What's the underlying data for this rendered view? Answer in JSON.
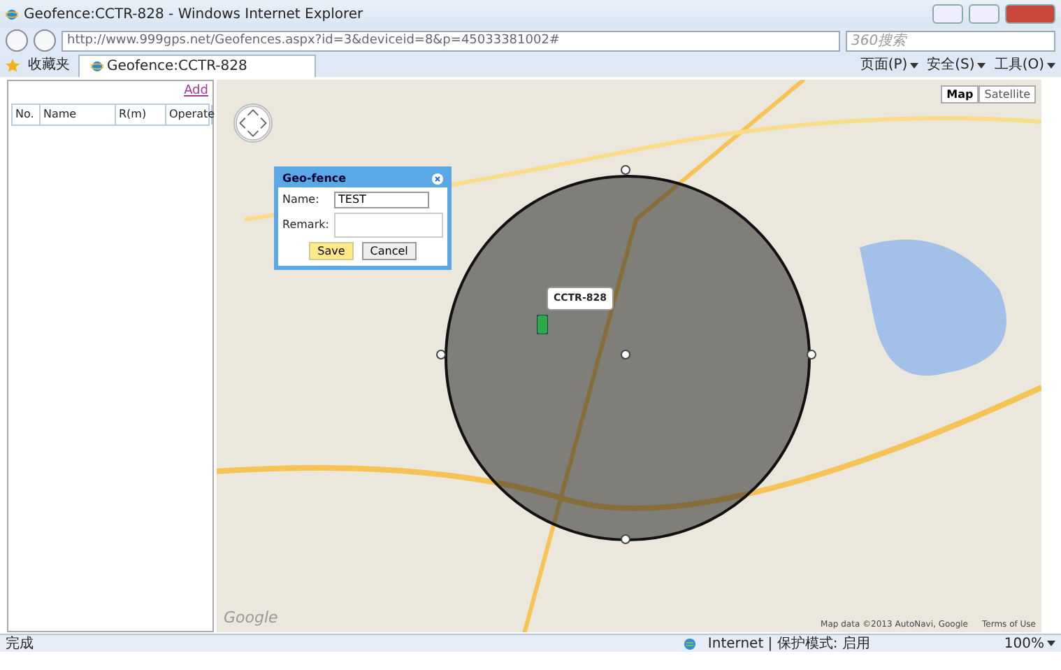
{
  "window": {
    "title": "Geofence:CCTR-828 - Windows Internet Explorer"
  },
  "address_bar": {
    "url": "http://www.999gps.net/Geofences.aspx?id=3&deviceid=8&p=45033381002#",
    "search_placeholder": "360搜索"
  },
  "favorites": {
    "label": "收藏夹"
  },
  "tab": {
    "title": "Geofence:CCTR-828"
  },
  "command_bar": [
    "页面(P)",
    "安全(S)",
    "工具(O)"
  ],
  "sidebar": {
    "add_link": "Add",
    "columns": [
      "No.",
      "Name",
      "R(m)",
      "Operate"
    ]
  },
  "map": {
    "types": [
      {
        "label": "Map",
        "selected": true
      },
      {
        "label": "Satellite",
        "selected": false
      }
    ],
    "marker_label": "CCTR-828",
    "logo": "Google",
    "attribution": "Map data ©2013 AutoNavi, Google",
    "terms": "Terms of Use"
  },
  "dialog": {
    "title": "Geo-fence",
    "name_label": "Name:",
    "name_value": "TEST",
    "remark_label": "Remark:",
    "buttons": [
      "Save",
      "Cancel"
    ]
  },
  "status_bar": {
    "text": "完成",
    "zone": "Internet | 保护模式: 启用",
    "zoom": "100%"
  }
}
